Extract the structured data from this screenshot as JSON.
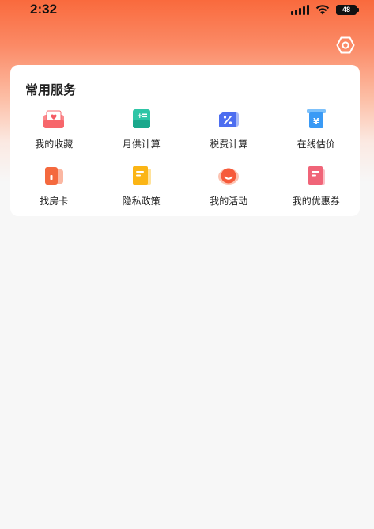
{
  "status": {
    "time": "2:32",
    "battery": "48"
  },
  "services": {
    "title": "常用服务",
    "items": [
      {
        "label": "我的收藏",
        "icon": "favorites-icon"
      },
      {
        "label": "月供计算",
        "icon": "monthly-payment-calculator-icon"
      },
      {
        "label": "税费计算",
        "icon": "tax-calculator-icon"
      },
      {
        "label": "在线估价",
        "icon": "online-valuation-icon"
      },
      {
        "label": "找房卡",
        "icon": "house-finder-card-icon"
      },
      {
        "label": "隐私政策",
        "icon": "privacy-policy-icon"
      },
      {
        "label": "我的活动",
        "icon": "my-activities-icon"
      },
      {
        "label": "我的优惠券",
        "icon": "my-coupons-icon"
      }
    ]
  },
  "colors": {
    "header_top": "#f96a3d",
    "page_background": "#f7f7f7",
    "card": "#ffffff"
  }
}
